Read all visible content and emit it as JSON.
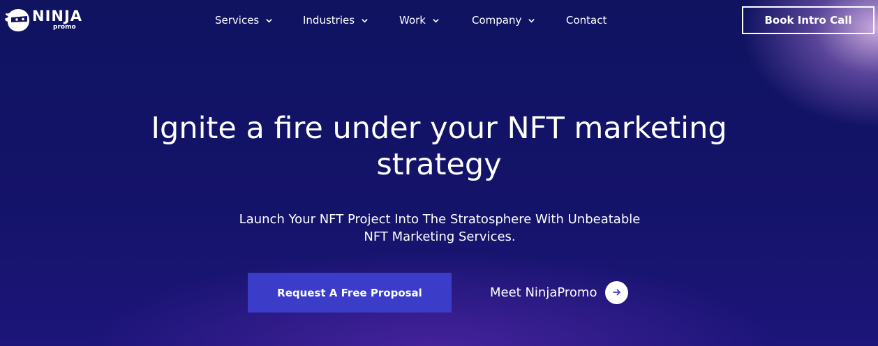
{
  "brand": {
    "name": "NINJA",
    "tagline": "promo"
  },
  "nav": {
    "items": [
      {
        "label": "Services",
        "has_dropdown": true
      },
      {
        "label": "Industries",
        "has_dropdown": true
      },
      {
        "label": "Work",
        "has_dropdown": true
      },
      {
        "label": "Company",
        "has_dropdown": true
      },
      {
        "label": "Contact",
        "has_dropdown": false
      }
    ],
    "cta_label": "Book Intro Call"
  },
  "hero": {
    "headline_line1": "Ignite a fire under your NFT marketing",
    "headline_line2": "strategy",
    "subline_line1": "Launch Your NFT Project Into The Stratosphere With Unbeatable",
    "subline_line2": "NFT Marketing Services.",
    "primary_cta": "Request A Free Proposal",
    "secondary_cta": "Meet NinjaPromo"
  },
  "colors": {
    "background": "#12135e",
    "primary_button": "#3b3dc8",
    "text": "#ffffff",
    "glow": "#d6b4e6"
  },
  "icons": {
    "dropdown": "chevron-down-icon",
    "secondary_cta": "arrow-right-icon",
    "logo": "ninja-head-icon"
  }
}
